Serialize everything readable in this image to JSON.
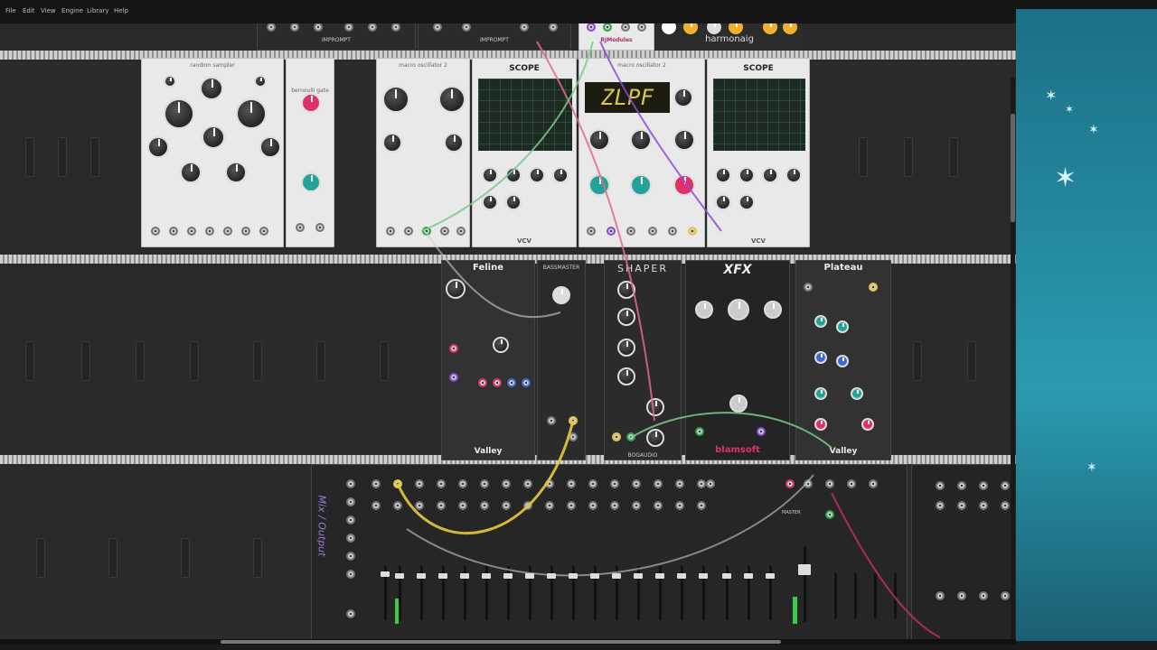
{
  "menu": [
    "File",
    "Edit",
    "View",
    "Engine",
    "Library",
    "Help"
  ],
  "modules": {
    "impromptu_1": "IMPROMPT",
    "impromptu_2": "IMPROMPT",
    "rjmodules": "RJModules",
    "harmonaig": "harmonaig",
    "random_sampler": "random sampler",
    "bernoulli_gate": "bernoulli gate",
    "macro_osc_1": "macro oscillator 2",
    "macro_osc_2": "macro oscillator 2",
    "scope_1": "SCOPE",
    "scope_2": "SCOPE",
    "scope_footer": "VCV",
    "lpf_display": "ZLPF",
    "feline": "Feline",
    "bassmaster": "BASSMASTER",
    "shaper": "SHAPER",
    "xfx": "XFX",
    "plateau": "Plateau",
    "valley_1": "Valley",
    "valley_2": "Valley",
    "bogaudio": "BOGAUDIO",
    "blamsoft": "blamsoft",
    "mixer_title": "Mix / Output",
    "mixer_master": "MASTER"
  },
  "colors": {
    "accent_yellow": "#e8c93a",
    "accent_pink": "#e0306a",
    "accent_teal": "#22a39a",
    "cable_green": "#7fc98a",
    "cable_purple": "#8e4ad8"
  }
}
